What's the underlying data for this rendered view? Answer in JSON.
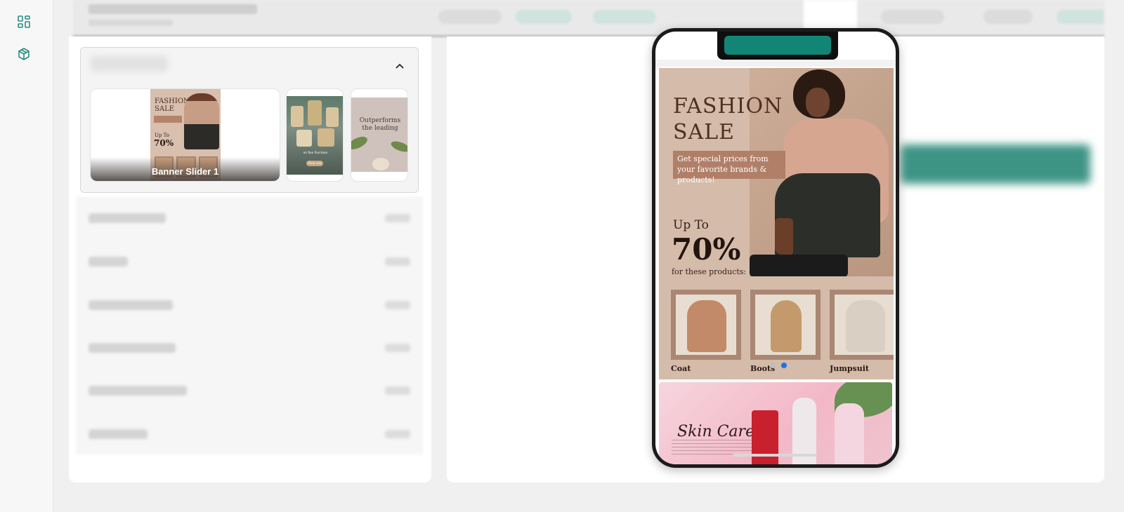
{
  "rail": {
    "icons": [
      "dashboard-icon",
      "package-icon"
    ]
  },
  "left_panel": {
    "section": {
      "thumbnails": [
        {
          "label": "Banner Slider 1",
          "mini_title": "FASHION SALE",
          "mini_upto": "Up To",
          "mini_pct": "70%"
        },
        {
          "mini_button": "Shop now",
          "mini_text": "on Your Purchase"
        },
        {
          "mini_text": "Outperforms the leading"
        }
      ]
    }
  },
  "preview": {
    "banner": {
      "title": "FASHION SALE",
      "subtitle": "Get special prices from your favorite brands & products!",
      "upto": "Up To",
      "percent": "70%",
      "for_text": "for these products:",
      "products": [
        "Coat",
        "Boots",
        "Jumpsuit"
      ]
    },
    "dots": {
      "count": 2,
      "active_index": 1,
      "active_color": "#1a73e8",
      "inactive_color": "#bdbdbd"
    },
    "skin_banner": {
      "title": "Skin Care"
    }
  },
  "colors": {
    "accent": "#2a8c82",
    "notch_bar": "#128576",
    "fashion_bg": "#d5bba9",
    "fashion_band": "#b17f68"
  }
}
